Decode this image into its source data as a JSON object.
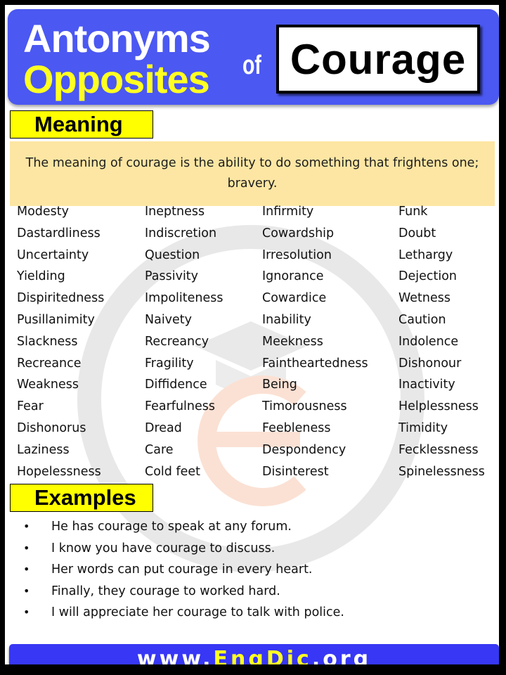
{
  "header": {
    "line1": "Antonyms",
    "line2": "Opposites",
    "connector": "of",
    "word": "Courage"
  },
  "meaning": {
    "label": "Meaning",
    "text": "The meaning of courage is the ability to do something that frightens one; bravery."
  },
  "antonyms": {
    "columns": [
      [
        "Modesty",
        "Dastardliness",
        "Uncertainty",
        "Yielding",
        "Dispiritedness",
        "Pusillanimity",
        "Slackness",
        "Recreance",
        "Weakness",
        "Fear",
        "Dishonorus",
        "Laziness",
        "Hopelessness"
      ],
      [
        "Ineptness",
        "Indiscretion",
        "Question",
        "Passivity",
        "Impoliteness",
        "Naivety",
        "Recreancy",
        "Fragility",
        "Diffidence",
        "Fearfulness",
        "Dread",
        "Care",
        "Cold feet"
      ],
      [
        "Infirmity",
        "Cowardship",
        "Irresolution",
        "Ignorance",
        "Cowardice",
        "Inability",
        "Meekness",
        "Faintheartedness",
        "Being",
        "Timorousness",
        "Feebleness",
        "Despondency",
        "Disinterest"
      ],
      [
        "Funk",
        "Doubt",
        "Lethargy",
        "Dejection",
        "Wetness",
        "Caution",
        "Indolence",
        "Dishonour",
        "Inactivity",
        "Helplessness",
        "Timidity",
        "Fecklessness",
        "Spinelessness"
      ]
    ]
  },
  "examples": {
    "label": "Examples",
    "bullet": "•",
    "items": [
      "He has courage to speak at any forum.",
      "I know you have courage to discuss.",
      "Her words can put courage in every heart.",
      "Finally, they courage to worked hard.",
      "I will appreciate her courage to talk with police."
    ]
  },
  "footer": {
    "prefix": "www.",
    "brand": "EngDic",
    "suffix": ".org"
  },
  "colors": {
    "header_blue": "#4b58f2",
    "footer_blue": "#3737f5",
    "label_yellow": "#ffff00",
    "meaning_bg": "#fde59f",
    "accent_yellow": "#ffff22"
  }
}
